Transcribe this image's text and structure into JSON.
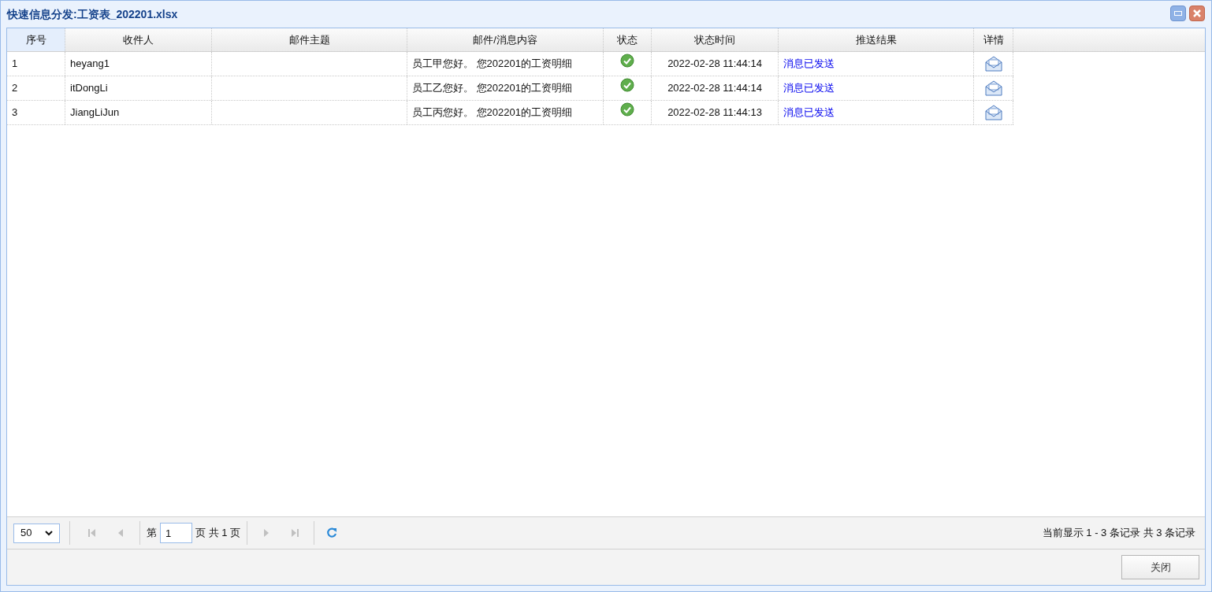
{
  "window": {
    "title": "快速信息分发:工资表_202201.xlsx"
  },
  "table": {
    "columns": [
      "序号",
      "收件人",
      "邮件主题",
      "邮件/消息内容",
      "状态",
      "状态时间",
      "推送结果",
      "详情"
    ],
    "rows": [
      {
        "index": "1",
        "recipient": "heyang1",
        "content": "员工甲您好。 您202201的工资明细",
        "sent_ok": true,
        "time": "2022-02-28 11:44:14",
        "result": "消息已发送"
      },
      {
        "index": "2",
        "recipient": "itDongLi",
        "content": "员工乙您好。 您202201的工资明细",
        "sent_ok": true,
        "time": "2022-02-28 11:44:14",
        "result": "消息已发送"
      },
      {
        "index": "3",
        "recipient": "JiangLiJun",
        "content": "员工丙您好。 您202201的工资明细",
        "sent_ok": true,
        "time": "2022-02-28 11:44:13",
        "result": "消息已发送"
      }
    ]
  },
  "pager": {
    "page_size": "50",
    "first_disabled": true,
    "prev_disabled": true,
    "next_disabled": true,
    "last_disabled": true,
    "page_prefix": "第",
    "page": "1",
    "page_suffix": "页 共 1 页",
    "summary": "当前显示 1 - 3 条记录 共 3 条记录"
  },
  "buttons": [
    "关闭"
  ]
}
